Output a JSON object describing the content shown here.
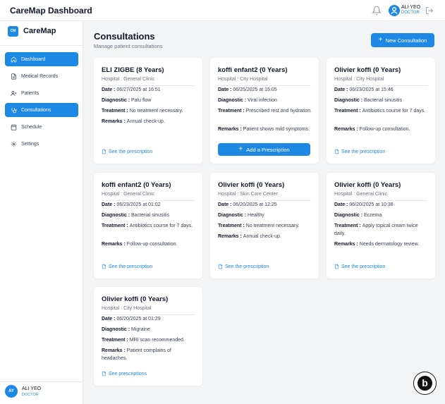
{
  "header": {
    "app_title": "CareMap Dashboard",
    "user_name": "ALI YEO",
    "user_role": "DOCTOR"
  },
  "sidebar": {
    "logo_initials": "CM",
    "brand": "CareMap",
    "items": [
      {
        "label": "Dashboard",
        "icon": "home-icon",
        "active": true
      },
      {
        "label": "Medical Records",
        "icon": "document-icon",
        "active": false
      },
      {
        "label": "Patients",
        "icon": "users-icon",
        "active": false
      },
      {
        "label": "Consultations",
        "icon": "stethoscope-icon",
        "active": true
      },
      {
        "label": "Schedule",
        "icon": "calendar-icon",
        "active": false
      },
      {
        "label": "Settings",
        "icon": "gear-icon",
        "active": false
      }
    ],
    "user_initials": "AY",
    "user_name": "ALI YEO",
    "user_role": "DOCTOR"
  },
  "main": {
    "title": "Consultations",
    "subtitle": "Manage patient consultations",
    "new_button": "New Consultation"
  },
  "labels": {
    "date": "Date : ",
    "diagnostic": "Diagnostic : ",
    "treatment": "Treatment : ",
    "remarks": "Remarks : "
  },
  "cards": [
    {
      "patient": "ELI ZIGBE (8 Years)",
      "hospital": "Hospital : General Clinic",
      "date": "06/27/2025 at 16:51",
      "diagnostic": "Palu flow",
      "treatment": "No treatment necessary.",
      "remarks": "Annual check-up.",
      "action": "See the prescription"
    },
    {
      "patient": "koffi enfant2 (0 Years)",
      "hospital": "Hospital : City Hospital",
      "date": "06/25/2025 at 15:05",
      "diagnostic": "Viral infection",
      "treatment": "Prescribed rest and hydration.",
      "remarks": "Patient shows mild symptoms.",
      "action": "Add a Prescription"
    },
    {
      "patient": "Olivier koffi (0 Years)",
      "hospital": "Hospital : City Hospital",
      "date": "06/23/2025 at 15:46",
      "diagnostic": "Bacterial sinusitis",
      "treatment": "Antibiotics course for 7 days.",
      "remarks": "Follow-up consultation.",
      "action": "See the prescription"
    },
    {
      "patient": "koffi enfant2 (0 Years)",
      "hospital": "Hospital : General Clinic",
      "date": "06/23/2025 at 01:02",
      "diagnostic": "Bacterial sinusitis",
      "treatment": "Antibiotics course for 7 days.",
      "remarks": "Follow-up consultation.",
      "action": "See the prescription"
    },
    {
      "patient": "Olivier koffi (0 Years)",
      "hospital": "Hospital : Skin Care Center",
      "date": "06/20/2025 at 12:25",
      "diagnostic": "Healthy",
      "treatment": "No treatment necessary.",
      "remarks": "Annual check-up.",
      "action": "See the prescription"
    },
    {
      "patient": "Olivier koffi (0 Years)",
      "hospital": "Hospital : General Clinic",
      "date": "06/20/2025 at 10:38",
      "diagnostic": "Eczema",
      "treatment": "Apply topical cream twice daily.",
      "remarks": "Needs dermatology review.",
      "action": "See the prescription"
    },
    {
      "patient": "Olivier koffi (0 Years)",
      "hospital": "Hospital : City Hospital",
      "date": "06/20/2025 at 01:29",
      "diagnostic": "Migraine",
      "treatment": "MRI scan recommended.",
      "remarks": "Patient complains of headaches.",
      "action": "See prescriptions"
    }
  ],
  "colors": {
    "accent": "#1e88e5",
    "background": "#f3f4f6"
  }
}
